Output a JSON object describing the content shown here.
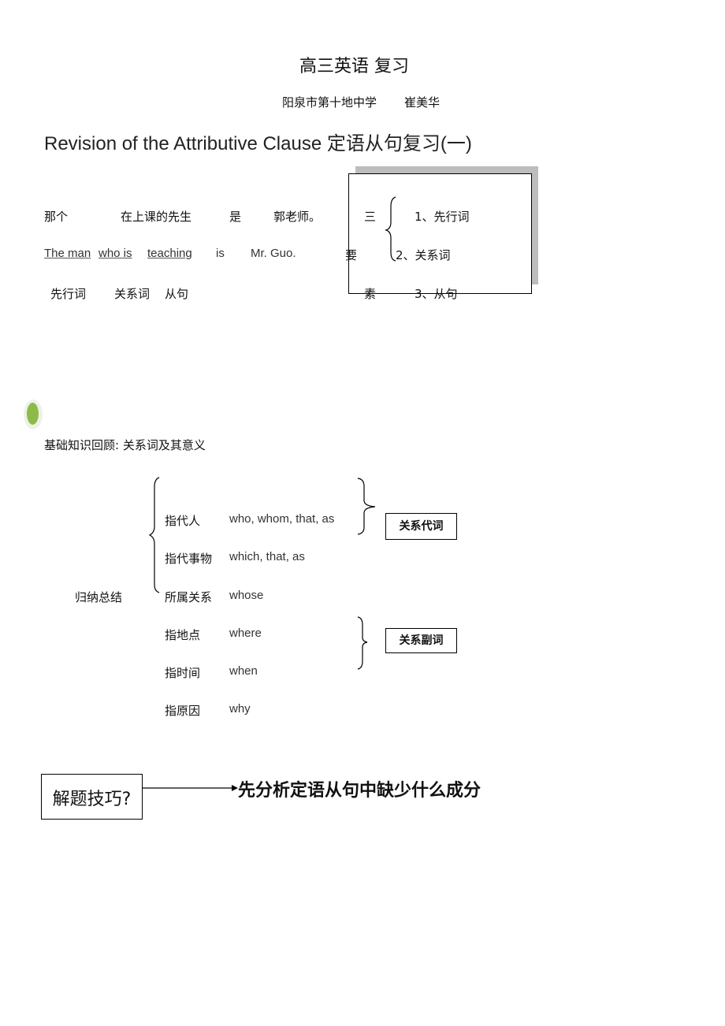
{
  "header": {
    "title": "高三英语 复习",
    "school": "阳泉市第十地中学",
    "author": "崔美华"
  },
  "heading": "Revision of the Attributive Clause  定语从句复习(一)",
  "example": {
    "chinese": [
      "那个",
      "在上课的先生",
      "是",
      "郭老师。"
    ],
    "english": [
      "The man",
      "who is",
      "teaching",
      "is",
      "Mr. Guo."
    ],
    "labels": [
      "先行词",
      "关系词",
      "从句"
    ]
  },
  "elements_box": {
    "vertical": [
      "三",
      "要",
      "素"
    ],
    "items": [
      "1、先行词",
      "2、关系词",
      "3、从句"
    ]
  },
  "review": {
    "title": "基础知识回顾: 关系词及其意义",
    "summary_label": "归纳总结",
    "rows": [
      {
        "category": "指代人",
        "words": "who, whom, that, as"
      },
      {
        "category": "指代事物",
        "words": "which, that, as"
      },
      {
        "category": "所属关系",
        "words": "whose"
      },
      {
        "category": "指地点",
        "words": "where"
      },
      {
        "category": "指时间",
        "words": "when"
      },
      {
        "category": "指原因",
        "words": "why"
      }
    ],
    "pronoun_label": "关系代词",
    "adverb_label": "关系副词"
  },
  "tip": {
    "box_label": "解题技巧?",
    "text": "先分析定语从句中缺少什么成分"
  },
  "colors": {
    "bullet": "#8dbb4a",
    "shadow": "#bdbdbd"
  }
}
